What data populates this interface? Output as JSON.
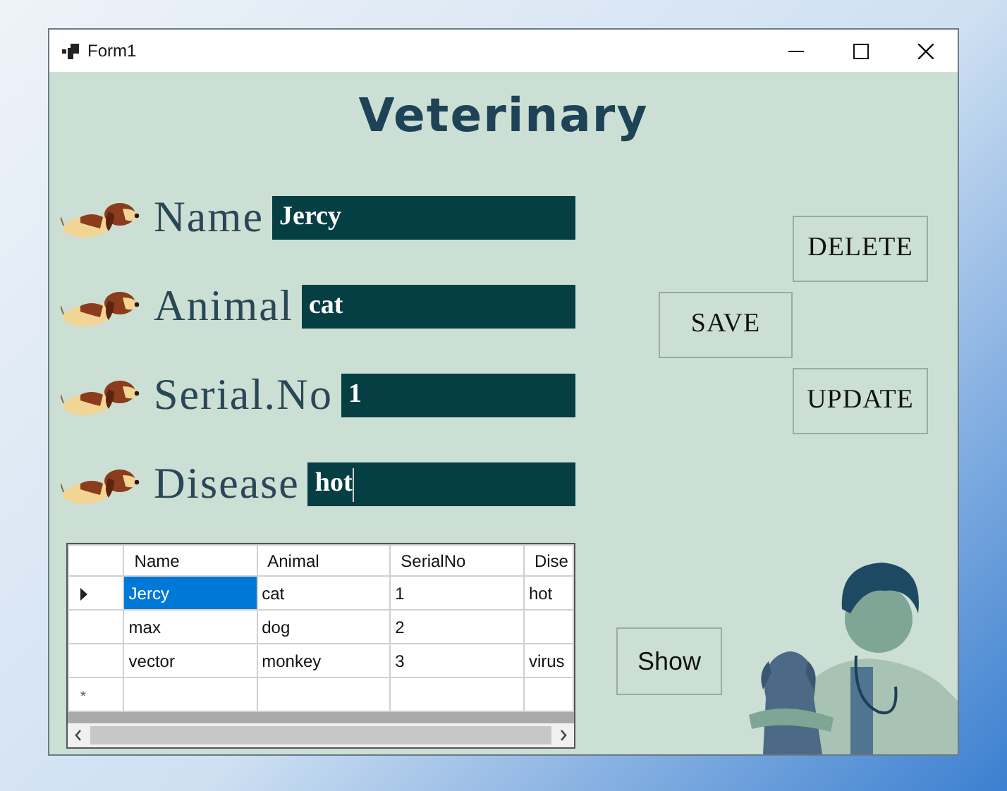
{
  "window": {
    "title": "Form1"
  },
  "heading": "Veterinary",
  "fields": [
    {
      "label": "Name",
      "value": "Jercy",
      "focused": false
    },
    {
      "label": "Animal",
      "value": "cat",
      "focused": false
    },
    {
      "label": "Serial.No",
      "value": "1",
      "focused": false
    },
    {
      "label": "Disease",
      "value": "hot",
      "focused": true
    }
  ],
  "buttons": [
    {
      "label": "DELETE"
    },
    {
      "label": "SAVE"
    },
    {
      "label": "UPDATE"
    }
  ],
  "show_button": {
    "label": "Show"
  },
  "grid": {
    "columns": [
      "Name",
      "Animal",
      "SerialNo",
      "Dise"
    ],
    "rows": [
      {
        "current": true,
        "cells": [
          {
            "text": "Jercy",
            "selected": true
          },
          {
            "text": "cat",
            "selected": false
          },
          {
            "text": "1",
            "selected": false
          },
          {
            "text": "hot",
            "selected": false
          }
        ]
      },
      {
        "current": false,
        "cells": [
          {
            "text": "max",
            "selected": false
          },
          {
            "text": "dog",
            "selected": false
          },
          {
            "text": "2",
            "selected": false
          },
          {
            "selected": false
          }
        ]
      },
      {
        "current": false,
        "cells": [
          {
            "text": "vector",
            "selected": false
          },
          {
            "text": "monkey",
            "selected": false
          },
          {
            "text": "3",
            "selected": false
          },
          {
            "text": "virus",
            "selected": false
          }
        ]
      }
    ],
    "new_row_marker": "*"
  }
}
